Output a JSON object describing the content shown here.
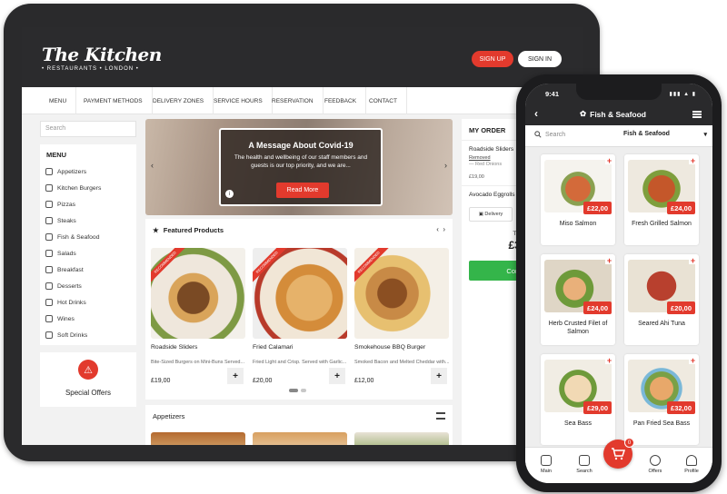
{
  "tablet": {
    "logo": {
      "main": "The Kitchen",
      "sub": "• RESTAURANTS • LONDON •"
    },
    "header": {
      "signup": "SIGN UP",
      "signin": "SIGN IN"
    },
    "nav": [
      "MENU",
      "PAYMENT METHODS",
      "DELIVERY ZONES",
      "SERVICE HOURS",
      "RESERVATION",
      "FEEDBACK",
      "CONTACT"
    ],
    "search_placeholder": "Search",
    "menu": {
      "title": "MENU",
      "items": [
        "Appetizers",
        "Kitchen Burgers",
        "Pizzas",
        "Steaks",
        "Fish & Seafood",
        "Salads",
        "Breakfast",
        "Desserts",
        "Hot Drinks",
        "Wines",
        "Soft Drinks"
      ]
    },
    "special_offers": "Special Offers",
    "banner": {
      "title": "A Message About Covid-19",
      "text": "The health and wellbeing of our staff members and guests is our top priority, and we are...",
      "button": "Read More"
    },
    "featured": {
      "title": "Featured Products",
      "ribbon": "RECOMMENDED",
      "products": [
        {
          "name": "Roadside Sliders",
          "desc": "Bite-Sized Burgers on Mini-Buns Served...",
          "price": "£19,00"
        },
        {
          "name": "Fried Calamari",
          "desc": "Fried Light and Crisp. Served with Garlic...",
          "price": "£20,00"
        },
        {
          "name": "Smokehouse BBQ Burger",
          "desc": "Smoked Bacon and Melted Cheddar with...",
          "price": "£12,00"
        }
      ]
    },
    "appetizers_title": "Appetizers",
    "order": {
      "title": "MY ORDER",
      "items": [
        {
          "name": "Roadside Sliders",
          "remove": "Removed",
          "note": "— Red Onions",
          "price": "£19,00"
        },
        {
          "name": "Avocado Eggrolls"
        }
      ],
      "delivery": "Delivery",
      "total_label": "TOTAL",
      "total": "£39,0",
      "confirm": "Confirm O"
    }
  },
  "phone": {
    "time": "9:41",
    "title": "Fish & Seafood",
    "search_placeholder": "Search",
    "category": "Fish & Seafood",
    "items": [
      {
        "name": "Miso Salmon",
        "price": "£22,00"
      },
      {
        "name": "Fresh Grilled Salmon",
        "price": "£24,00"
      },
      {
        "name": "Herb Crusted Filet of Salmon",
        "price": "£24,00"
      },
      {
        "name": "Seared Ahi Tuna",
        "price": "£20,00"
      },
      {
        "name": "Sea Bass",
        "price": "£29,00"
      },
      {
        "name": "Pan Fried Sea Bass",
        "price": "£32,00"
      }
    ],
    "tabs": [
      "Main",
      "Search",
      "Offers",
      "Profile"
    ],
    "cart_count": "0"
  },
  "colors": {
    "accent": "#e23a2d",
    "header": "#2b2b2d",
    "confirm": "#34b54a"
  },
  "icons": [
    "search-icon",
    "star-icon",
    "bell-icon",
    "cart-icon",
    "fish-icon",
    "menu-icon",
    "back-icon"
  ]
}
